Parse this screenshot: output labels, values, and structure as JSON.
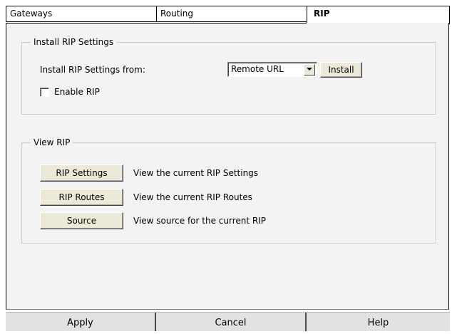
{
  "tabs": [
    "Gateways",
    "Routing",
    "RIP"
  ],
  "install_group": {
    "legend": "Install RIP Settings",
    "from_label": "Install RIP Settings from:",
    "source_select_value": "Remote URL",
    "install_button": "Install",
    "enable_label": "Enable RIP",
    "enable_checked": false
  },
  "view_group": {
    "legend": "View RIP",
    "rows": [
      {
        "button": "RIP Settings",
        "desc": "View the current RIP Settings"
      },
      {
        "button": "RIP Routes",
        "desc": "View the current RIP Routes"
      },
      {
        "button": "Source",
        "desc": "View source for the current RIP"
      }
    ]
  },
  "footer": {
    "apply": "Apply",
    "cancel": "Cancel",
    "help": "Help"
  }
}
